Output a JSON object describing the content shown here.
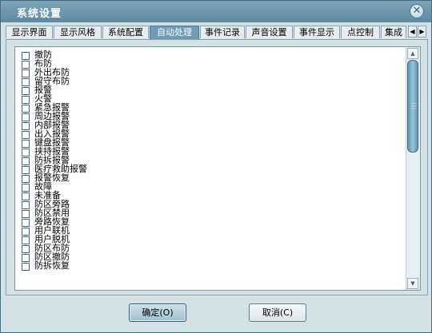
{
  "window": {
    "title": "系统设置"
  },
  "tabs": [
    {
      "label": "显示界面"
    },
    {
      "label": "显示风格"
    },
    {
      "label": "系统配置"
    },
    {
      "label": "自动处理",
      "active": true
    },
    {
      "label": "事件记录"
    },
    {
      "label": "声音设置"
    },
    {
      "label": "事件显示"
    },
    {
      "label": "点控制"
    },
    {
      "label": "集成"
    }
  ],
  "tab_scroll": {
    "left_icon": "◀",
    "right_icon": "▶"
  },
  "event_list": {
    "items": [
      {
        "label": "撤防",
        "checked": false
      },
      {
        "label": "布防",
        "checked": false
      },
      {
        "label": "外出布防",
        "checked": false
      },
      {
        "label": "留守布防",
        "checked": false
      },
      {
        "label": "报警",
        "checked": false
      },
      {
        "label": "火警",
        "checked": false
      },
      {
        "label": "紧急报警",
        "checked": false
      },
      {
        "label": "周边报警",
        "checked": false
      },
      {
        "label": "内部报警",
        "checked": false
      },
      {
        "label": "出入报警",
        "checked": false
      },
      {
        "label": "键盘报警",
        "checked": false
      },
      {
        "label": "挟持报警",
        "checked": false
      },
      {
        "label": "防拆报警",
        "checked": false
      },
      {
        "label": "医疗救助报警",
        "checked": false
      },
      {
        "label": "报警恢复",
        "checked": false
      },
      {
        "label": "故障",
        "checked": false
      },
      {
        "label": "未准备",
        "checked": false
      },
      {
        "label": "防区旁路",
        "checked": false
      },
      {
        "label": "防区禁用",
        "checked": false
      },
      {
        "label": "旁路恢复",
        "checked": false
      },
      {
        "label": "用户联机",
        "checked": false
      },
      {
        "label": "用户脱机",
        "checked": false
      },
      {
        "label": "防区布防",
        "checked": false
      },
      {
        "label": "防区撤防",
        "checked": false
      },
      {
        "label": "防拆恢复",
        "checked": false
      }
    ]
  },
  "scrollbar": {
    "up_icon": "▲",
    "down_icon": "▼",
    "position": 0.0
  },
  "buttons": {
    "ok_label": "确定(O)",
    "cancel_label": "取消(C)"
  },
  "icons": {
    "close": "close-icon"
  },
  "colors": {
    "titlebar": "#6b93a9",
    "active_tab": "#6d9db5",
    "panel": "#d4e2e6"
  }
}
